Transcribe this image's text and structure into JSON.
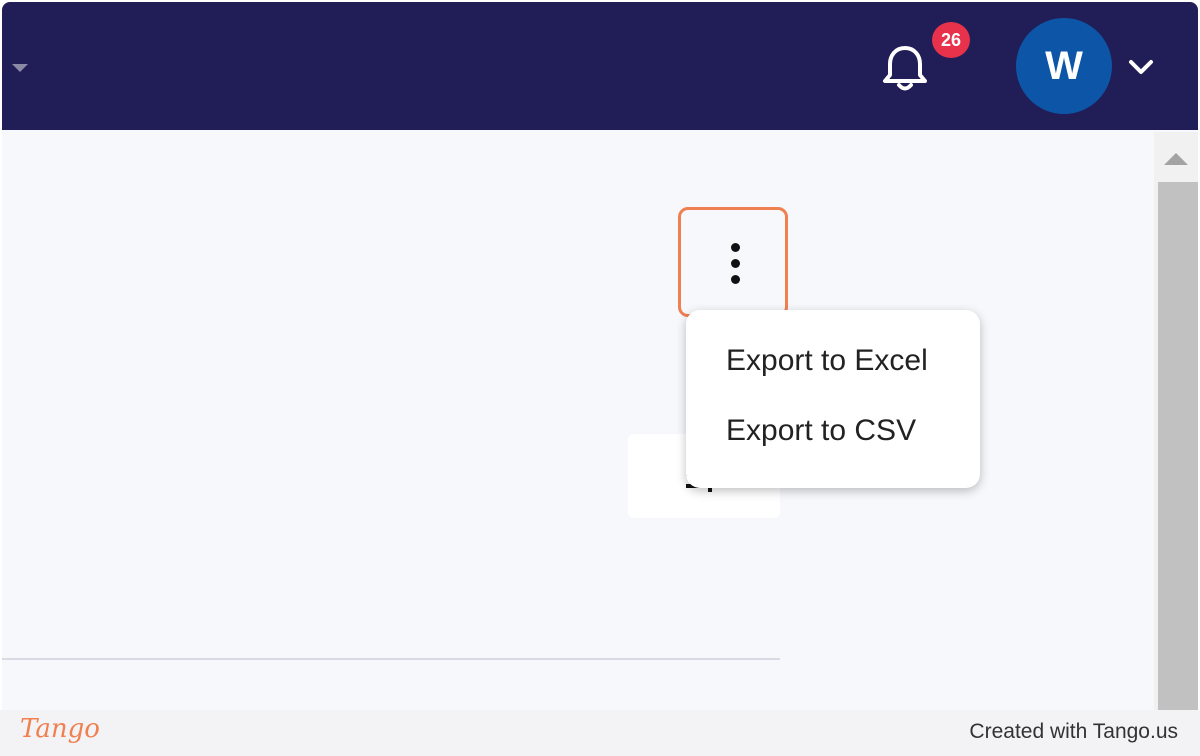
{
  "header": {
    "notification_count": "26",
    "avatar_initial": "W"
  },
  "icons": {
    "bell": "bell-icon",
    "chevron": "chevron-down-icon",
    "menu": "more-vertical-icon"
  },
  "context_menu": {
    "items": [
      "Export to Excel",
      "Export to CSV"
    ]
  },
  "footer": {
    "logo": "Tango",
    "credit": "Created with Tango.us"
  },
  "colors": {
    "header_bg": "#211d57",
    "badge": "#e8324b",
    "avatar": "#0d55a6",
    "highlight": "#f08050"
  }
}
